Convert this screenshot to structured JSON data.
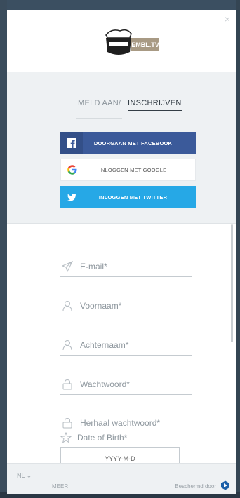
{
  "header": {
    "close_label": "×",
    "logo_text": "EMBL.TV"
  },
  "tabs": {
    "login": "MELD AAN",
    "separator": "/",
    "signup": "INSCHRIJVEN"
  },
  "social": {
    "facebook": "DOORGAAN MET FACEBOOK",
    "google": "INLOGGEN MET GOOGLE",
    "twitter": "INLOGGEN MET TWITTER"
  },
  "form": {
    "email": "E-mail*",
    "firstname": "Voornaam*",
    "lastname": "Achternaam*",
    "password": "Wachtwoord*",
    "password_repeat": "Herhaal wachtwoord*",
    "dob_label": "Date of Birth*",
    "dob_placeholder": "YYYY-M-D"
  },
  "footer": {
    "language": "NL ⌄",
    "more": "MEER",
    "protected_by": "Beschermd door"
  },
  "colors": {
    "facebook": "#3b5a9a",
    "twitter": "#26a8e6",
    "panel": "#eef1f3"
  }
}
